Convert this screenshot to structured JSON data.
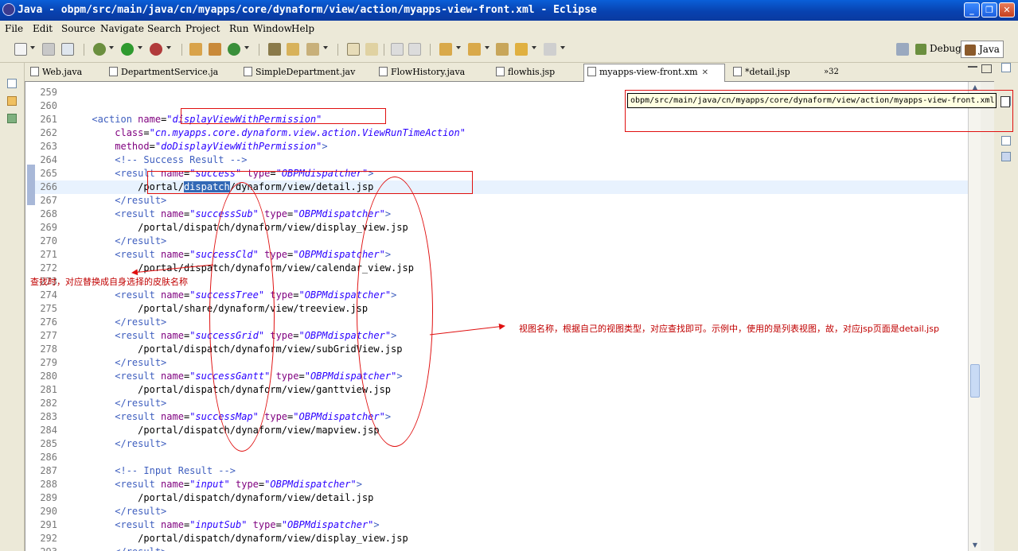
{
  "window": {
    "title": "Java - obpm/src/main/java/cn/myapps/core/dynaform/view/action/myapps-view-front.xml - Eclipse",
    "minimize": "_",
    "maximize": "❐",
    "close": "✕"
  },
  "menu": [
    "File",
    "Edit",
    "Source",
    "Navigate",
    "Search",
    "Project",
    "Run",
    "Window",
    "Help"
  ],
  "perspectives": {
    "debug": "Debug",
    "java": "Java"
  },
  "tabs": [
    {
      "label": "Web.java",
      "active": false,
      "dirty": false
    },
    {
      "label": "DepartmentService.ja",
      "active": false,
      "dirty": false
    },
    {
      "label": "SimpleDepartment.jav",
      "active": false,
      "dirty": false
    },
    {
      "label": "FlowHistory.java",
      "active": false,
      "dirty": false
    },
    {
      "label": "flowhis.jsp",
      "active": false,
      "dirty": false
    },
    {
      "label": "myapps-view-front.xm",
      "active": true,
      "dirty": false
    },
    {
      "label": "*detail.jsp",
      "active": false,
      "dirty": true
    }
  ],
  "tabs_overflow": "»32",
  "tooltip": "obpm/src/main/java/cn/myapps/core/dynaform/view/action/myapps-view-front.xml",
  "annotations": {
    "left_note": "查找时，对应替换成自身选择的皮肤名称",
    "right_note": "视图名称，根据自己的视图类型，对应查找即可。示例中，使用的是列表视图，故，对应jsp页面是detail.jsp"
  },
  "code_lines": [
    {
      "n": "259",
      "parts": []
    },
    {
      "n": "260",
      "parts": []
    },
    {
      "n": "261",
      "parts": [
        [
          "txt",
          "      "
        ],
        [
          "tag",
          "<action "
        ],
        [
          "attr",
          "name"
        ],
        [
          "txt",
          "="
        ],
        [
          "val",
          "\"displayViewWithPermission\""
        ]
      ]
    },
    {
      "n": "262",
      "parts": [
        [
          "txt",
          "          "
        ],
        [
          "attr",
          "class"
        ],
        [
          "txt",
          "="
        ],
        [
          "val",
          "\"cn.myapps.core.dynaform.view.action.ViewRunTimeAction\""
        ]
      ]
    },
    {
      "n": "263",
      "parts": [
        [
          "txt",
          "          "
        ],
        [
          "attr",
          "method"
        ],
        [
          "txt",
          "="
        ],
        [
          "val",
          "\"doDisplayViewWithPermission\""
        ],
        [
          "tag",
          ">"
        ]
      ]
    },
    {
      "n": "264",
      "parts": [
        [
          "txt",
          "          "
        ],
        [
          "cmt",
          "<!-- Success Result -->"
        ]
      ]
    },
    {
      "n": "265",
      "parts": [
        [
          "txt",
          "          "
        ],
        [
          "tag",
          "<result "
        ],
        [
          "attr",
          "name"
        ],
        [
          "txt",
          "="
        ],
        [
          "val",
          "\"success\""
        ],
        [
          "txt",
          " "
        ],
        [
          "attr",
          "type"
        ],
        [
          "txt",
          "="
        ],
        [
          "val",
          "\"OBPMdispatcher\""
        ],
        [
          "tag",
          ">"
        ]
      ]
    },
    {
      "n": "266",
      "parts": [
        [
          "txt",
          "              /portal/"
        ],
        [
          "sel",
          "dispatch"
        ],
        [
          "txt",
          "/dynaform/view/detail.jsp"
        ]
      ],
      "current": true
    },
    {
      "n": "267",
      "parts": [
        [
          "txt",
          "          "
        ],
        [
          "tag",
          "</result>"
        ]
      ]
    },
    {
      "n": "268",
      "parts": [
        [
          "txt",
          "          "
        ],
        [
          "tag",
          "<result "
        ],
        [
          "attr",
          "name"
        ],
        [
          "txt",
          "="
        ],
        [
          "val",
          "\"successSub\""
        ],
        [
          "txt",
          " "
        ],
        [
          "attr",
          "type"
        ],
        [
          "txt",
          "="
        ],
        [
          "val",
          "\"OBPMdispatcher\""
        ],
        [
          "tag",
          ">"
        ]
      ]
    },
    {
      "n": "269",
      "parts": [
        [
          "txt",
          "              /portal/dispatch/dynaform/view/display_view.jsp"
        ]
      ]
    },
    {
      "n": "270",
      "parts": [
        [
          "txt",
          "          "
        ],
        [
          "tag",
          "</result>"
        ]
      ]
    },
    {
      "n": "271",
      "parts": [
        [
          "txt",
          "          "
        ],
        [
          "tag",
          "<result "
        ],
        [
          "attr",
          "name"
        ],
        [
          "txt",
          "="
        ],
        [
          "val",
          "\"successCld\""
        ],
        [
          "txt",
          " "
        ],
        [
          "attr",
          "type"
        ],
        [
          "txt",
          "="
        ],
        [
          "val",
          "\"OBPMdispatcher\""
        ],
        [
          "tag",
          ">"
        ]
      ]
    },
    {
      "n": "272",
      "parts": [
        [
          "txt",
          "              /portal/dispatch/dynaform/view/calendar_view.jsp"
        ]
      ]
    },
    {
      "n": "273",
      "parts": []
    },
    {
      "n": "274",
      "parts": [
        [
          "txt",
          "          "
        ],
        [
          "tag",
          "<result "
        ],
        [
          "attr",
          "name"
        ],
        [
          "txt",
          "="
        ],
        [
          "val",
          "\"successTree\""
        ],
        [
          "txt",
          " "
        ],
        [
          "attr",
          "type"
        ],
        [
          "txt",
          "="
        ],
        [
          "val",
          "\"OBPMdispatcher\""
        ],
        [
          "tag",
          ">"
        ]
      ]
    },
    {
      "n": "275",
      "parts": [
        [
          "txt",
          "              /portal/share/dynaform/view/treeview.jsp"
        ]
      ]
    },
    {
      "n": "276",
      "parts": [
        [
          "txt",
          "          "
        ],
        [
          "tag",
          "</result>"
        ]
      ]
    },
    {
      "n": "277",
      "parts": [
        [
          "txt",
          "          "
        ],
        [
          "tag",
          "<result "
        ],
        [
          "attr",
          "name"
        ],
        [
          "txt",
          "="
        ],
        [
          "val",
          "\"successGrid\""
        ],
        [
          "txt",
          " "
        ],
        [
          "attr",
          "type"
        ],
        [
          "txt",
          "="
        ],
        [
          "val",
          "\"OBPMdispatcher\""
        ],
        [
          "tag",
          ">"
        ]
      ]
    },
    {
      "n": "278",
      "parts": [
        [
          "txt",
          "              /portal/dispatch/dynaform/view/subGridView.jsp"
        ]
      ]
    },
    {
      "n": "279",
      "parts": [
        [
          "txt",
          "          "
        ],
        [
          "tag",
          "</result>"
        ]
      ]
    },
    {
      "n": "280",
      "parts": [
        [
          "txt",
          "          "
        ],
        [
          "tag",
          "<result "
        ],
        [
          "attr",
          "name"
        ],
        [
          "txt",
          "="
        ],
        [
          "val",
          "\"successGantt\""
        ],
        [
          "txt",
          " "
        ],
        [
          "attr",
          "type"
        ],
        [
          "txt",
          "="
        ],
        [
          "val",
          "\"OBPMdispatcher\""
        ],
        [
          "tag",
          ">"
        ]
      ]
    },
    {
      "n": "281",
      "parts": [
        [
          "txt",
          "              /portal/dispatch/dynaform/view/ganttview.jsp"
        ]
      ]
    },
    {
      "n": "282",
      "parts": [
        [
          "txt",
          "          "
        ],
        [
          "tag",
          "</result>"
        ]
      ]
    },
    {
      "n": "283",
      "parts": [
        [
          "txt",
          "          "
        ],
        [
          "tag",
          "<result "
        ],
        [
          "attr",
          "name"
        ],
        [
          "txt",
          "="
        ],
        [
          "val",
          "\"successMap\""
        ],
        [
          "txt",
          " "
        ],
        [
          "attr",
          "type"
        ],
        [
          "txt",
          "="
        ],
        [
          "val",
          "\"OBPMdispatcher\""
        ],
        [
          "tag",
          ">"
        ]
      ]
    },
    {
      "n": "284",
      "parts": [
        [
          "txt",
          "              /portal/dispatch/dynaform/view/mapview.jsp"
        ]
      ]
    },
    {
      "n": "285",
      "parts": [
        [
          "txt",
          "          "
        ],
        [
          "tag",
          "</result>"
        ]
      ]
    },
    {
      "n": "286",
      "parts": []
    },
    {
      "n": "287",
      "parts": [
        [
          "txt",
          "          "
        ],
        [
          "cmt",
          "<!-- Input Result -->"
        ]
      ]
    },
    {
      "n": "288",
      "parts": [
        [
          "txt",
          "          "
        ],
        [
          "tag",
          "<result "
        ],
        [
          "attr",
          "name"
        ],
        [
          "txt",
          "="
        ],
        [
          "val",
          "\"input\""
        ],
        [
          "txt",
          " "
        ],
        [
          "attr",
          "type"
        ],
        [
          "txt",
          "="
        ],
        [
          "val",
          "\"OBPMdispatcher\""
        ],
        [
          "tag",
          ">"
        ]
      ]
    },
    {
      "n": "289",
      "parts": [
        [
          "txt",
          "              /portal/dispatch/dynaform/view/detail.jsp"
        ]
      ]
    },
    {
      "n": "290",
      "parts": [
        [
          "txt",
          "          "
        ],
        [
          "tag",
          "</result>"
        ]
      ]
    },
    {
      "n": "291",
      "parts": [
        [
          "txt",
          "          "
        ],
        [
          "tag",
          "<result "
        ],
        [
          "attr",
          "name"
        ],
        [
          "txt",
          "="
        ],
        [
          "val",
          "\"inputSub\""
        ],
        [
          "txt",
          " "
        ],
        [
          "attr",
          "type"
        ],
        [
          "txt",
          "="
        ],
        [
          "val",
          "\"OBPMdispatcher\""
        ],
        [
          "tag",
          ">"
        ]
      ]
    },
    {
      "n": "292",
      "parts": [
        [
          "txt",
          "              /portal/dispatch/dynaform/view/display_view.jsp"
        ]
      ]
    },
    {
      "n": "293",
      "parts": [
        [
          "txt",
          "          "
        ],
        [
          "tag",
          "</result>"
        ]
      ]
    }
  ]
}
